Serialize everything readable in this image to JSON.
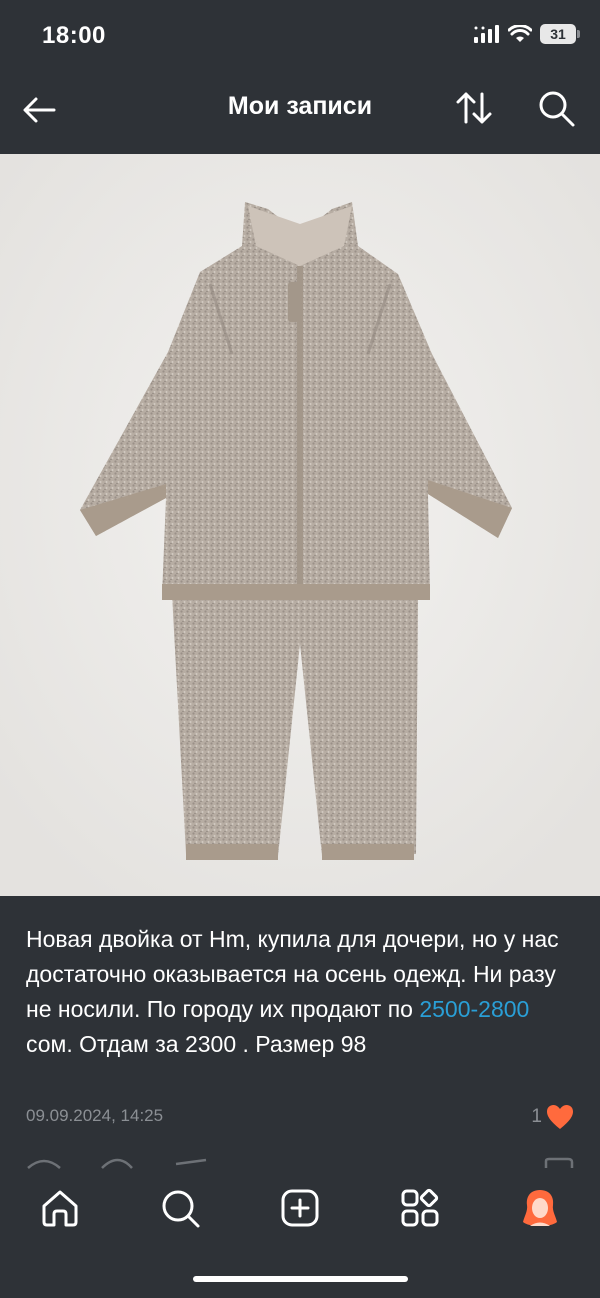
{
  "status": {
    "time": "18:00",
    "battery": "31"
  },
  "header": {
    "title": "Мои записи",
    "back_icon": "arrow-left-icon",
    "sort_icon": "sort-arrows-icon",
    "search_icon": "search-icon"
  },
  "post": {
    "image_description": "baby knit fleece set",
    "text_before_price": "Новая двойка от Hm, купила для дочери, но у нас достаточно оказывается на осень одежд. Ни разу не носили. По городу их продают по ",
    "price_range": "2500-2800",
    "text_after_price": " сом. Отдам за 2300 . Размер 98",
    "date": "09.09.2024, 14:25",
    "likes": "1",
    "accent_color": "#2a9fd6",
    "like_color": "#ff6a3d"
  },
  "tabs": [
    {
      "icon": "home-icon"
    },
    {
      "icon": "search-icon"
    },
    {
      "icon": "add-post-icon"
    },
    {
      "icon": "services-icon"
    },
    {
      "icon": "profile-avatar-icon"
    }
  ]
}
